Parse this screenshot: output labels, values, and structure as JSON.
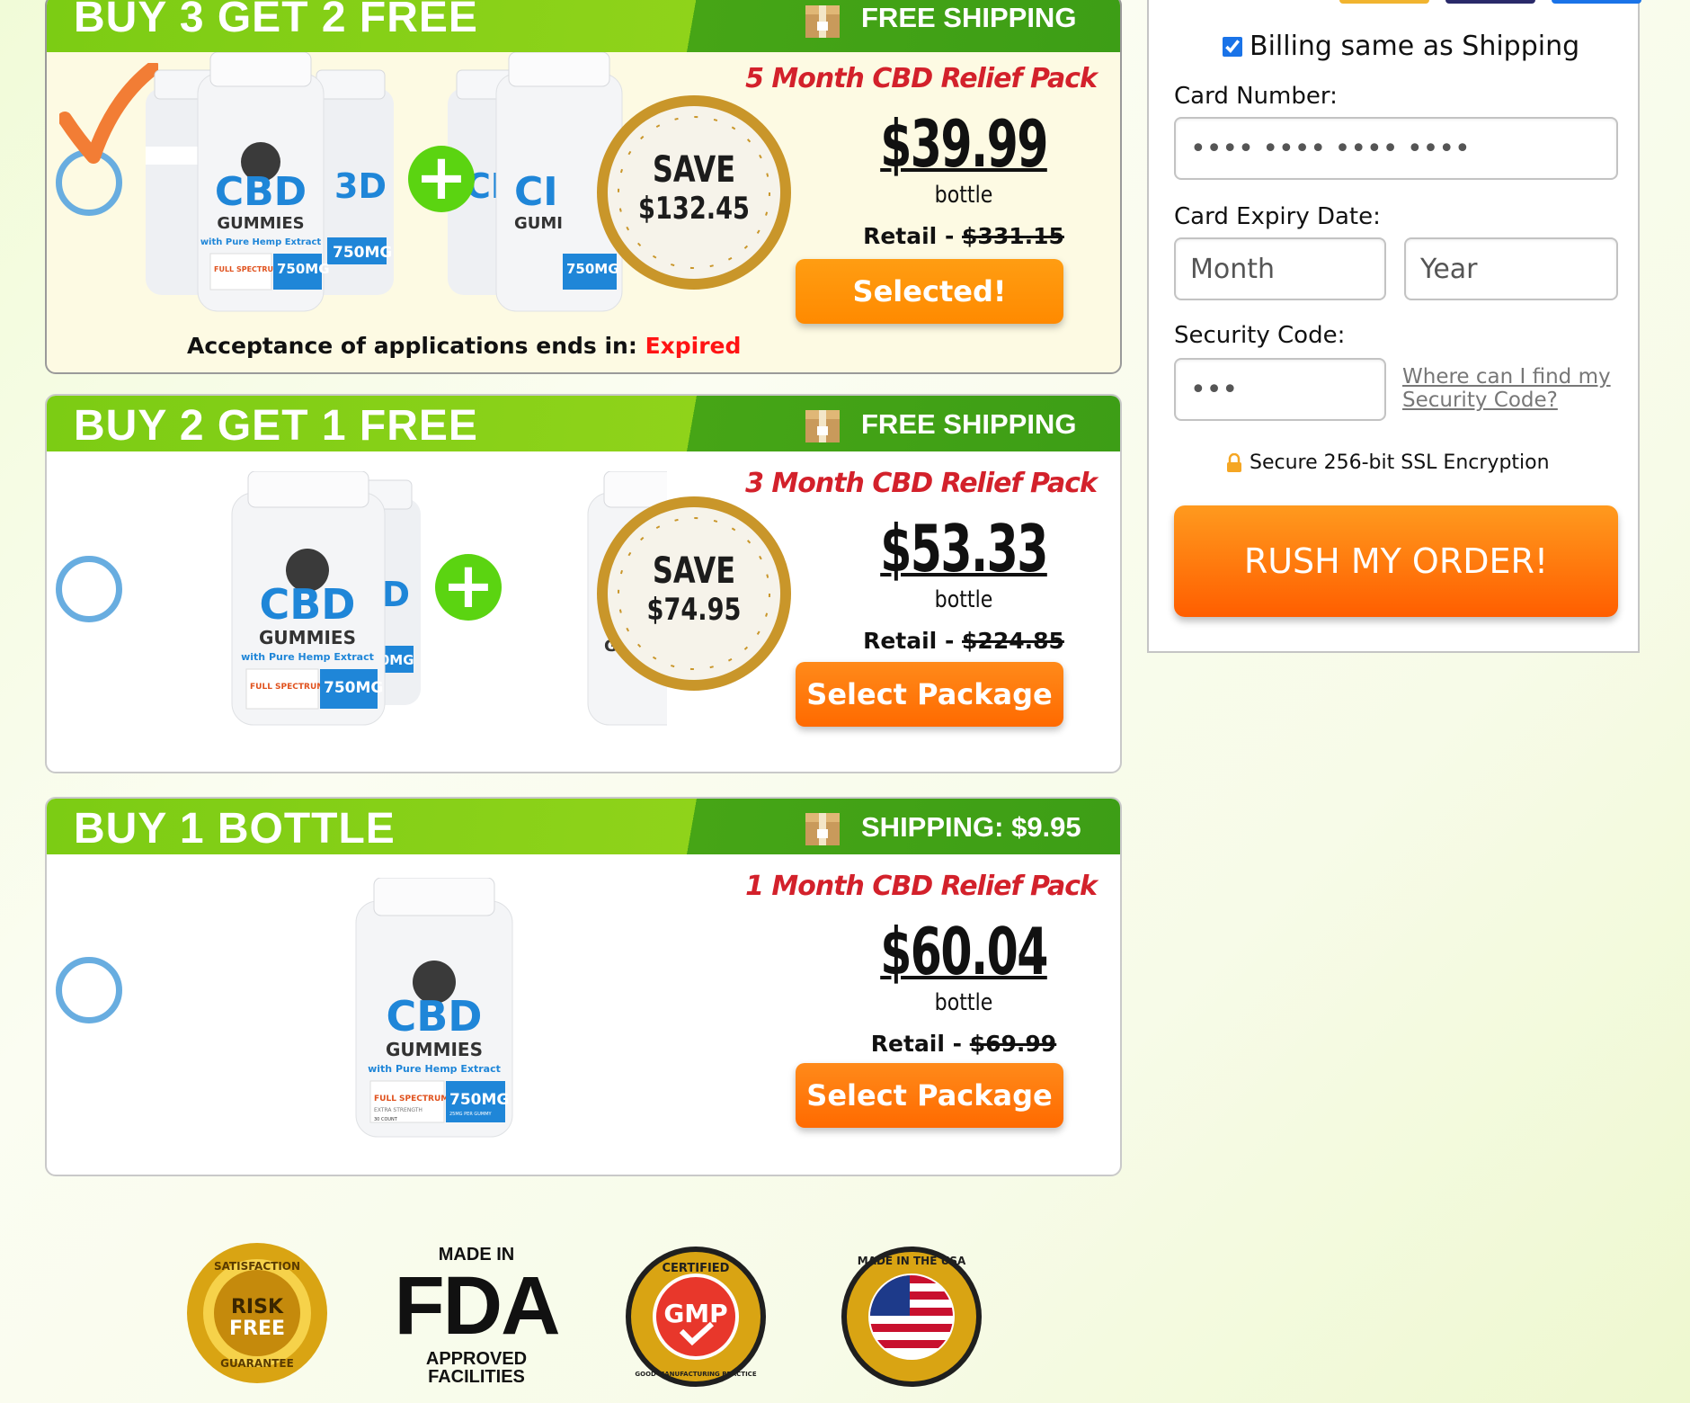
{
  "packages": [
    {
      "header_title": "BUY 3 GET 2 FREE",
      "shipping_label": "FREE SHIPPING",
      "pack_name": "5 Month CBD Relief Pack",
      "price": "$39.99",
      "unit": "bottle",
      "retail_label": "Retail - ",
      "retail_price": "$331.15",
      "save_label": "SAVE",
      "save_amount": "$132.45",
      "button_label": "Selected!",
      "selected": true,
      "acceptance_text": "Acceptance of applications ends in: ",
      "acceptance_status": "Expired"
    },
    {
      "header_title": "BUY 2 GET 1 FREE",
      "shipping_label": "FREE SHIPPING",
      "pack_name": "3 Month CBD Relief Pack",
      "price": "$53.33",
      "unit": "bottle",
      "retail_label": "Retail - ",
      "retail_price": "$224.85",
      "save_label": "SAVE",
      "save_amount": "$74.95",
      "button_label": "Select Package",
      "selected": false
    },
    {
      "header_title": "BUY 1 BOTTLE",
      "shipping_label": "SHIPPING: $9.95",
      "pack_name": "1 Month CBD Relief Pack",
      "price": "$60.04",
      "unit": "bottle",
      "retail_label": "Retail - ",
      "retail_price": "$69.99",
      "button_label": "Select Package",
      "selected": false
    }
  ],
  "bottle_label": {
    "brand": "CBD",
    "product": "GUMMIES",
    "sub": "with Pure Hemp Extract",
    "spectrum": "FULL SPECTRUM",
    "strength": "EXTRA STRENGTH",
    "mg": "750MG",
    "per": "25MG PER GUMMY",
    "count": "30 COUNT"
  },
  "payment": {
    "billing_same_label": "Billing same as Shipping",
    "billing_same_checked": true,
    "card_number_label": "Card Number:",
    "card_number_placeholder": "•••• •••• •••• ••••",
    "expiry_label": "Card Expiry Date:",
    "month_placeholder": "Month",
    "year_placeholder": "Year",
    "security_label": "Security Code:",
    "security_placeholder": "•••",
    "security_help_link": "Where can I find my Security Code?",
    "ssl_text": "Secure 256-bit SSL Encryption",
    "submit_label": "RUSH MY ORDER!"
  },
  "badges": {
    "risk_free_top": "SATISFACTION",
    "risk_free_main1": "RISK",
    "risk_free_main2": "FREE",
    "risk_free_bottom": "GUARANTEE",
    "fda_top": "MADE IN",
    "fda_main": "FDA",
    "fda_bottom1": "APPROVED",
    "fda_bottom2": "FACILITIES",
    "gmp_top": "CERTIFIED",
    "gmp_main": "GMP",
    "gmp_ring": "GOOD MANUFACTURING PRACTICE",
    "usa_ring": "MADE IN THE USA"
  },
  "colors": {
    "header_green": "#7ccc14",
    "header_dark_green": "#3d9e16",
    "orange_button": "#ff6a00",
    "pack_red": "#d3212b",
    "radio_blue": "#68ade0",
    "expired_red": "#ff1414"
  }
}
